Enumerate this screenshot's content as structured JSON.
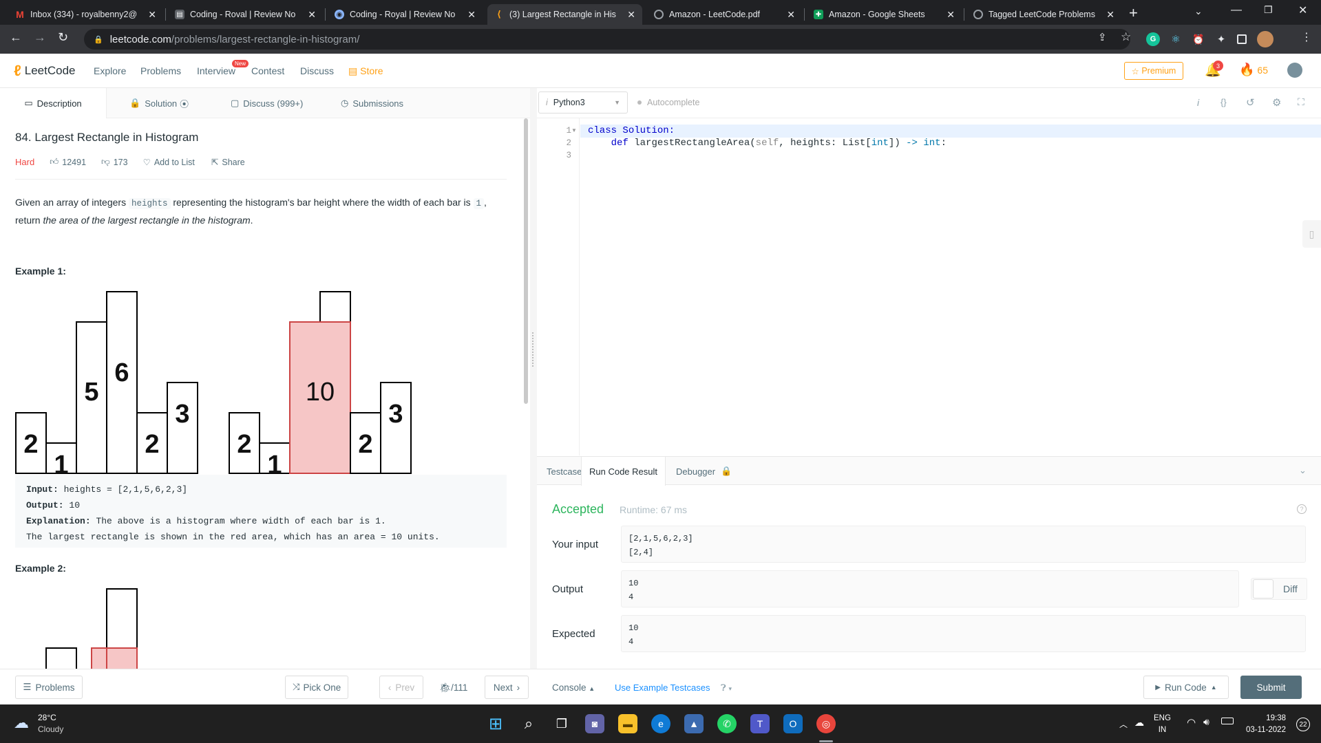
{
  "browser": {
    "tabs": [
      {
        "title": "Inbox (334) - royalbenny2@",
        "icon": "gmail-icon",
        "active": false
      },
      {
        "title": "Coding - Roval | Review No",
        "icon": "coding-icon",
        "active": false
      },
      {
        "title": "Coding - Royal | Review No",
        "icon": "coding-icon",
        "active": false
      },
      {
        "title": "(3) Largest Rectangle in His",
        "icon": "leetcode-icon",
        "active": true
      },
      {
        "title": "Amazon - LeetCode.pdf",
        "icon": "globe-icon",
        "active": false
      },
      {
        "title": "Amazon - Google Sheets",
        "icon": "sheets-icon",
        "active": false
      },
      {
        "title": "Tagged LeetCode Problems",
        "icon": "globe-icon",
        "active": false
      }
    ],
    "url_host": "leetcode.com",
    "url_path": "/problems/largest-rectangle-in-histogram/"
  },
  "nav": {
    "logo": "LeetCode",
    "links": [
      "Explore",
      "Problems",
      "Interview",
      "Contest",
      "Discuss"
    ],
    "new_badge": "New",
    "store": "Store",
    "premium": "Premium",
    "notif_count": "3",
    "streak": "65"
  },
  "left_tabs": [
    "Description",
    "Solution",
    "Discuss (999+)",
    "Submissions"
  ],
  "problem": {
    "title": "84. Largest Rectangle in Histogram",
    "difficulty": "Hard",
    "likes": "12491",
    "dislikes": "173",
    "add_to_list": "Add to List",
    "share": "Share",
    "desc_1": "Given an array of integers",
    "desc_code_1": "heights",
    "desc_2": "representing the histogram's bar height where the width of each bar is",
    "desc_code_2": "1",
    "desc_3": ", return",
    "desc_italic": "the area of the largest rectangle in the histogram",
    "desc_end": ".",
    "example1_title": "Example 1:",
    "example1_input_label": "Input:",
    "example1_input": "heights = [2,1,5,6,2,3]",
    "example1_output_label": "Output:",
    "example1_output": "10",
    "example1_expl_label": "Explanation:",
    "example1_expl_1": "The above is a histogram where width of each bar is 1.",
    "example1_expl_2": "The largest rectangle is shown in the red area, which has an area = 10 units.",
    "example2_title": "Example 2:",
    "hist_labels": [
      "2",
      "1",
      "5",
      "6",
      "2",
      "3"
    ],
    "hist_area_label": "10"
  },
  "editor": {
    "language": "Python3",
    "autocomplete": "Autocomplete",
    "line_numbers": [
      "1",
      "2",
      "3"
    ],
    "line1_kw": "class",
    "line1_rest": "Solution:",
    "line2_kw": "def",
    "line2_name": "largestRectangleArea(",
    "line2_self": "self",
    "line2_mid": ", heights: List[",
    "line2_int": "int",
    "line2_close": "])",
    "line2_arrow": "->",
    "line2_ret": "int",
    "line2_colon": ":"
  },
  "result_tabs": [
    "Testcase",
    "Run Code Result",
    "Debugger"
  ],
  "result": {
    "status": "Accepted",
    "runtime": "Runtime: 67 ms",
    "your_input_label": "Your input",
    "your_input": [
      "[2,1,5,6,2,3]",
      "[2,4]"
    ],
    "output_label": "Output",
    "output": [
      "10",
      "4"
    ],
    "expected_label": "Expected",
    "expected": [
      "10",
      "4"
    ],
    "diff": "Diff"
  },
  "bottom": {
    "problems": "Problems",
    "pick_one": "Pick One",
    "prev": "Prev",
    "page": "/111",
    "next": "Next",
    "console": "Console",
    "use_example": "Use Example Testcases",
    "run_code": "Run Code",
    "submit": "Submit"
  },
  "taskbar": {
    "temp": "28°C",
    "weather": "Cloudy",
    "lang_1": "ENG",
    "lang_2": "IN",
    "time": "19:38",
    "date": "03-11-2022",
    "notif": "22"
  }
}
